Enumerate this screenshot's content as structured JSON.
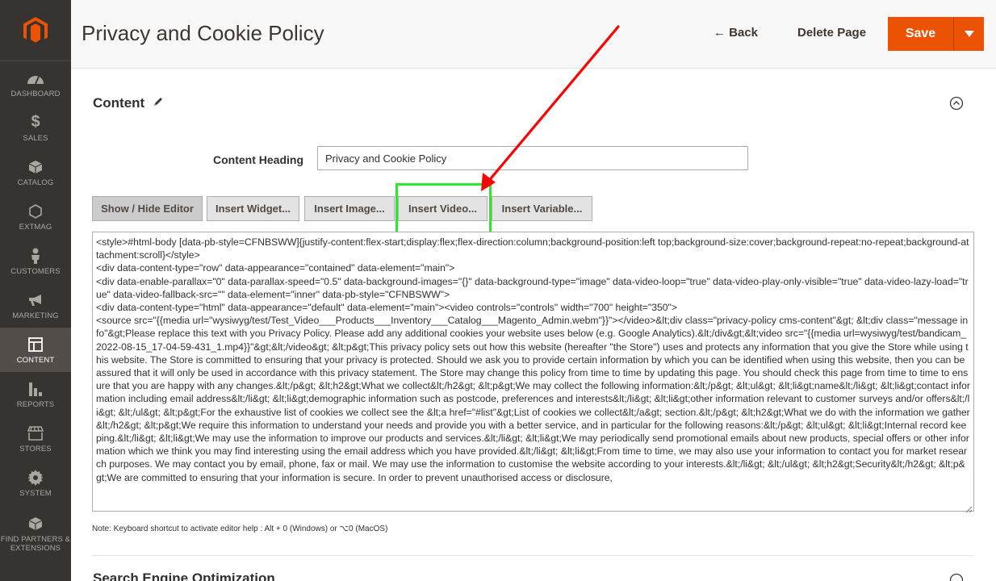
{
  "sidebar": {
    "logo": "magento-logo",
    "items": [
      {
        "label": "DASHBOARD",
        "icon": "dashboard-icon"
      },
      {
        "label": "SALES",
        "icon": "dollar-icon"
      },
      {
        "label": "CATALOG",
        "icon": "box-icon"
      },
      {
        "label": "EXTMAG",
        "icon": "hexagon-icon"
      },
      {
        "label": "CUSTOMERS",
        "icon": "person-icon"
      },
      {
        "label": "MARKETING",
        "icon": "megaphone-icon"
      },
      {
        "label": "CONTENT",
        "icon": "layout-icon"
      },
      {
        "label": "REPORTS",
        "icon": "bar-chart-icon"
      },
      {
        "label": "STORES",
        "icon": "storefront-icon"
      },
      {
        "label": "SYSTEM",
        "icon": "gear-icon"
      },
      {
        "label": "FIND PARTNERS & EXTENSIONS",
        "icon": "partners-box-icon"
      }
    ]
  },
  "header": {
    "title": "Privacy and Cookie Policy",
    "back_label": "← Back",
    "delete_label": "Delete Page",
    "save_label": "Save"
  },
  "content": {
    "section_title": "Content",
    "heading_label": "Content Heading",
    "heading_value": "Privacy and Cookie Policy",
    "buttons": {
      "show_hide": "Show / Hide Editor",
      "widget": "Insert Widget...",
      "image": "Insert Image...",
      "video": "Insert Video...",
      "variable": "Insert Variable..."
    },
    "editor_text": "<style>#html-body [data-pb-style=CFNBSWW]{justify-content:flex-start;display:flex;flex-direction:column;background-position:left top;background-size:cover;background-repeat:no-repeat;background-attachment:scroll}</style>\n<div data-content-type=\"row\" data-appearance=\"contained\" data-element=\"main\">\n<div data-enable-parallax=\"0\" data-parallax-speed=\"0.5\" data-background-images=\"{}\" data-background-type=\"image\" data-video-loop=\"true\" data-video-play-only-visible=\"true\" data-video-lazy-load=\"true\" data-video-fallback-src=\"\" data-element=\"inner\" data-pb-style=\"CFNBSWW\">\n<div data-content-type=\"html\" data-appearance=\"default\" data-element=\"main\"><video controls=\"controls\" width=\"700\" height=\"350\">\n<source src=\"{{media url=\"wysiwyg/test/Test_Video___Products___Inventory___Catalog___Magento_Admin.webm\"}}\"></video>&lt;div class=\"privacy-policy cms-content\"&gt; &lt;div class=\"message info\"&gt;Please replace this text with you Privacy Policy. Please add any additional cookies your website uses below (e.g. Google Analytics).&lt;/div&gt;&lt;video src=\"{{media url=wysiwyg/test/bandicam_2022-08-15_17-04-59-431_1.mp4}}\"&gt;&lt;/video&gt; &lt;p&gt;This privacy policy sets out how this website (hereafter \"the Store\") uses and protects any information that you give the Store while using this website. The Store is committed to ensuring that your privacy is protected. Should we ask you to provide certain information by which you can be identified when using this website, then you can be assured that it will only be used in accordance with this privacy statement. The Store may change this policy from time to time by updating this page. You should check this page from time to time to ensure that you are happy with any changes.&lt;/p&gt; &lt;h2&gt;What we collect&lt;/h2&gt; &lt;p&gt;We may collect the following information:&lt;/p&gt; &lt;ul&gt; &lt;li&gt;name&lt;/li&gt; &lt;li&gt;contact information including email address&lt;/li&gt; &lt;li&gt;demographic information such as postcode, preferences and interests&lt;/li&gt; &lt;li&gt;other information relevant to customer surveys and/or offers&lt;/li&gt; &lt;/ul&gt; &lt;p&gt;For the exhaustive list of cookies we collect see the &lt;a href=\"#list\"&gt;List of cookies we collect&lt;/a&gt; section.&lt;/p&gt; &lt;h2&gt;What we do with the information we gather&lt;/h2&gt; &lt;p&gt;We require this information to understand your needs and provide you with a better service, and in particular for the following reasons:&lt;/p&gt; &lt;ul&gt; &lt;li&gt;Internal record keeping.&lt;/li&gt; &lt;li&gt;We may use the information to improve our products and services.&lt;/li&gt; &lt;li&gt;We may periodically send promotional emails about new products, special offers or other information which we think you may find interesting using the email address which you have provided.&lt;/li&gt; &lt;li&gt;From time to time, we may also use your information to contact you for market research purposes. We may contact you by email, phone, fax or mail. We may use the information to customise the website according to your interests.&lt;/li&gt; &lt;/ul&gt; &lt;h2&gt;Security&lt;/h2&gt; &lt;p&gt;We are committed to ensuring that your information is secure. In order to prevent unauthorised access or disclosure,",
    "note": "Note: Keyboard shortcut to activate editor help : Alt + 0 (Windows) or ⌥0 (MacOS)"
  },
  "seo": {
    "section_title": "Search Engine Optimization"
  },
  "colors": {
    "accent": "#eb5202",
    "sidebar": "#373330",
    "highlight": "#2ee62e",
    "arrow": "#ff0000"
  }
}
